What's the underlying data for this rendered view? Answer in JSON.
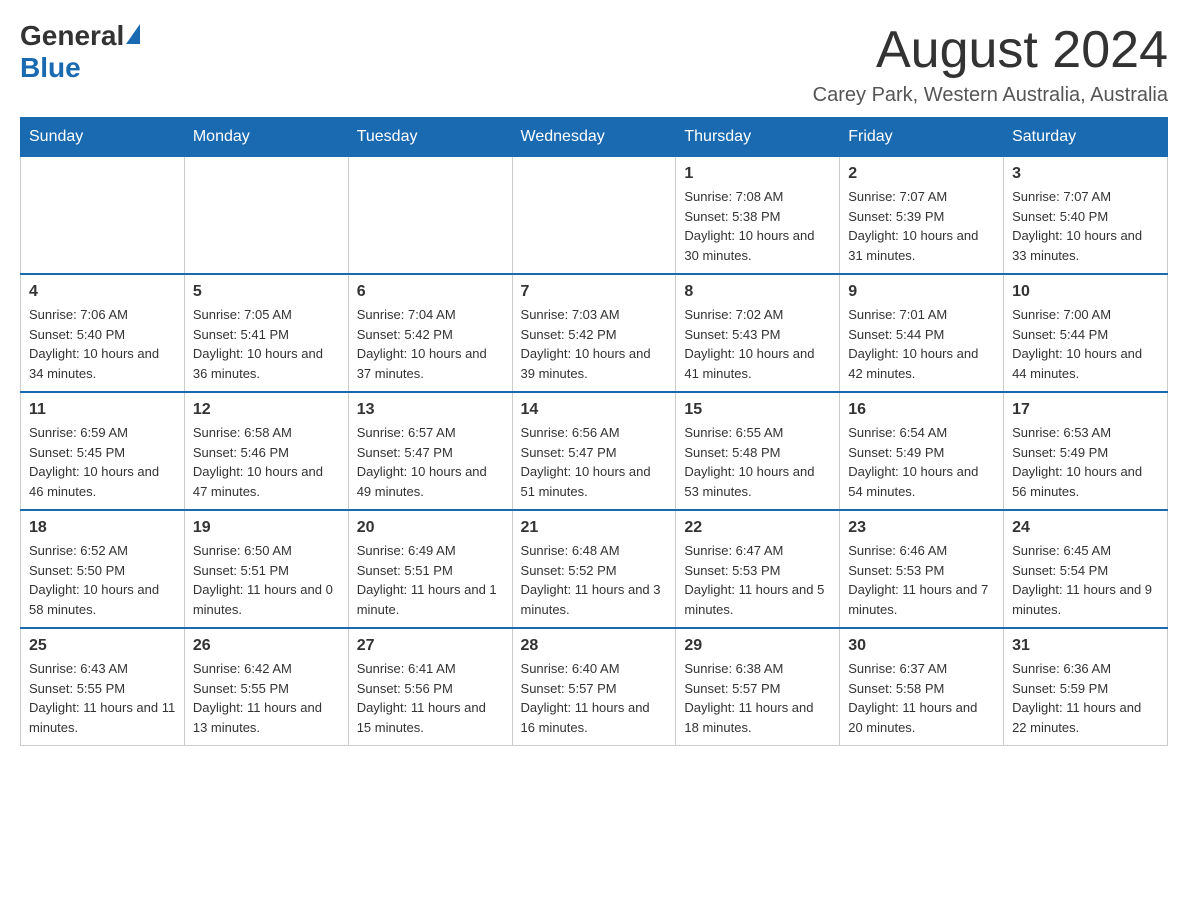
{
  "header": {
    "logo_general": "General",
    "logo_blue": "Blue",
    "month_title": "August 2024",
    "location": "Carey Park, Western Australia, Australia"
  },
  "weekdays": [
    "Sunday",
    "Monday",
    "Tuesday",
    "Wednesday",
    "Thursday",
    "Friday",
    "Saturday"
  ],
  "weeks": [
    [
      {
        "day": "",
        "sunrise": "",
        "sunset": "",
        "daylight": ""
      },
      {
        "day": "",
        "sunrise": "",
        "sunset": "",
        "daylight": ""
      },
      {
        "day": "",
        "sunrise": "",
        "sunset": "",
        "daylight": ""
      },
      {
        "day": "",
        "sunrise": "",
        "sunset": "",
        "daylight": ""
      },
      {
        "day": "1",
        "sunrise": "Sunrise: 7:08 AM",
        "sunset": "Sunset: 5:38 PM",
        "daylight": "Daylight: 10 hours and 30 minutes."
      },
      {
        "day": "2",
        "sunrise": "Sunrise: 7:07 AM",
        "sunset": "Sunset: 5:39 PM",
        "daylight": "Daylight: 10 hours and 31 minutes."
      },
      {
        "day": "3",
        "sunrise": "Sunrise: 7:07 AM",
        "sunset": "Sunset: 5:40 PM",
        "daylight": "Daylight: 10 hours and 33 minutes."
      }
    ],
    [
      {
        "day": "4",
        "sunrise": "Sunrise: 7:06 AM",
        "sunset": "Sunset: 5:40 PM",
        "daylight": "Daylight: 10 hours and 34 minutes."
      },
      {
        "day": "5",
        "sunrise": "Sunrise: 7:05 AM",
        "sunset": "Sunset: 5:41 PM",
        "daylight": "Daylight: 10 hours and 36 minutes."
      },
      {
        "day": "6",
        "sunrise": "Sunrise: 7:04 AM",
        "sunset": "Sunset: 5:42 PM",
        "daylight": "Daylight: 10 hours and 37 minutes."
      },
      {
        "day": "7",
        "sunrise": "Sunrise: 7:03 AM",
        "sunset": "Sunset: 5:42 PM",
        "daylight": "Daylight: 10 hours and 39 minutes."
      },
      {
        "day": "8",
        "sunrise": "Sunrise: 7:02 AM",
        "sunset": "Sunset: 5:43 PM",
        "daylight": "Daylight: 10 hours and 41 minutes."
      },
      {
        "day": "9",
        "sunrise": "Sunrise: 7:01 AM",
        "sunset": "Sunset: 5:44 PM",
        "daylight": "Daylight: 10 hours and 42 minutes."
      },
      {
        "day": "10",
        "sunrise": "Sunrise: 7:00 AM",
        "sunset": "Sunset: 5:44 PM",
        "daylight": "Daylight: 10 hours and 44 minutes."
      }
    ],
    [
      {
        "day": "11",
        "sunrise": "Sunrise: 6:59 AM",
        "sunset": "Sunset: 5:45 PM",
        "daylight": "Daylight: 10 hours and 46 minutes."
      },
      {
        "day": "12",
        "sunrise": "Sunrise: 6:58 AM",
        "sunset": "Sunset: 5:46 PM",
        "daylight": "Daylight: 10 hours and 47 minutes."
      },
      {
        "day": "13",
        "sunrise": "Sunrise: 6:57 AM",
        "sunset": "Sunset: 5:47 PM",
        "daylight": "Daylight: 10 hours and 49 minutes."
      },
      {
        "day": "14",
        "sunrise": "Sunrise: 6:56 AM",
        "sunset": "Sunset: 5:47 PM",
        "daylight": "Daylight: 10 hours and 51 minutes."
      },
      {
        "day": "15",
        "sunrise": "Sunrise: 6:55 AM",
        "sunset": "Sunset: 5:48 PM",
        "daylight": "Daylight: 10 hours and 53 minutes."
      },
      {
        "day": "16",
        "sunrise": "Sunrise: 6:54 AM",
        "sunset": "Sunset: 5:49 PM",
        "daylight": "Daylight: 10 hours and 54 minutes."
      },
      {
        "day": "17",
        "sunrise": "Sunrise: 6:53 AM",
        "sunset": "Sunset: 5:49 PM",
        "daylight": "Daylight: 10 hours and 56 minutes."
      }
    ],
    [
      {
        "day": "18",
        "sunrise": "Sunrise: 6:52 AM",
        "sunset": "Sunset: 5:50 PM",
        "daylight": "Daylight: 10 hours and 58 minutes."
      },
      {
        "day": "19",
        "sunrise": "Sunrise: 6:50 AM",
        "sunset": "Sunset: 5:51 PM",
        "daylight": "Daylight: 11 hours and 0 minutes."
      },
      {
        "day": "20",
        "sunrise": "Sunrise: 6:49 AM",
        "sunset": "Sunset: 5:51 PM",
        "daylight": "Daylight: 11 hours and 1 minute."
      },
      {
        "day": "21",
        "sunrise": "Sunrise: 6:48 AM",
        "sunset": "Sunset: 5:52 PM",
        "daylight": "Daylight: 11 hours and 3 minutes."
      },
      {
        "day": "22",
        "sunrise": "Sunrise: 6:47 AM",
        "sunset": "Sunset: 5:53 PM",
        "daylight": "Daylight: 11 hours and 5 minutes."
      },
      {
        "day": "23",
        "sunrise": "Sunrise: 6:46 AM",
        "sunset": "Sunset: 5:53 PM",
        "daylight": "Daylight: 11 hours and 7 minutes."
      },
      {
        "day": "24",
        "sunrise": "Sunrise: 6:45 AM",
        "sunset": "Sunset: 5:54 PM",
        "daylight": "Daylight: 11 hours and 9 minutes."
      }
    ],
    [
      {
        "day": "25",
        "sunrise": "Sunrise: 6:43 AM",
        "sunset": "Sunset: 5:55 PM",
        "daylight": "Daylight: 11 hours and 11 minutes."
      },
      {
        "day": "26",
        "sunrise": "Sunrise: 6:42 AM",
        "sunset": "Sunset: 5:55 PM",
        "daylight": "Daylight: 11 hours and 13 minutes."
      },
      {
        "day": "27",
        "sunrise": "Sunrise: 6:41 AM",
        "sunset": "Sunset: 5:56 PM",
        "daylight": "Daylight: 11 hours and 15 minutes."
      },
      {
        "day": "28",
        "sunrise": "Sunrise: 6:40 AM",
        "sunset": "Sunset: 5:57 PM",
        "daylight": "Daylight: 11 hours and 16 minutes."
      },
      {
        "day": "29",
        "sunrise": "Sunrise: 6:38 AM",
        "sunset": "Sunset: 5:57 PM",
        "daylight": "Daylight: 11 hours and 18 minutes."
      },
      {
        "day": "30",
        "sunrise": "Sunrise: 6:37 AM",
        "sunset": "Sunset: 5:58 PM",
        "daylight": "Daylight: 11 hours and 20 minutes."
      },
      {
        "day": "31",
        "sunrise": "Sunrise: 6:36 AM",
        "sunset": "Sunset: 5:59 PM",
        "daylight": "Daylight: 11 hours and 22 minutes."
      }
    ]
  ]
}
